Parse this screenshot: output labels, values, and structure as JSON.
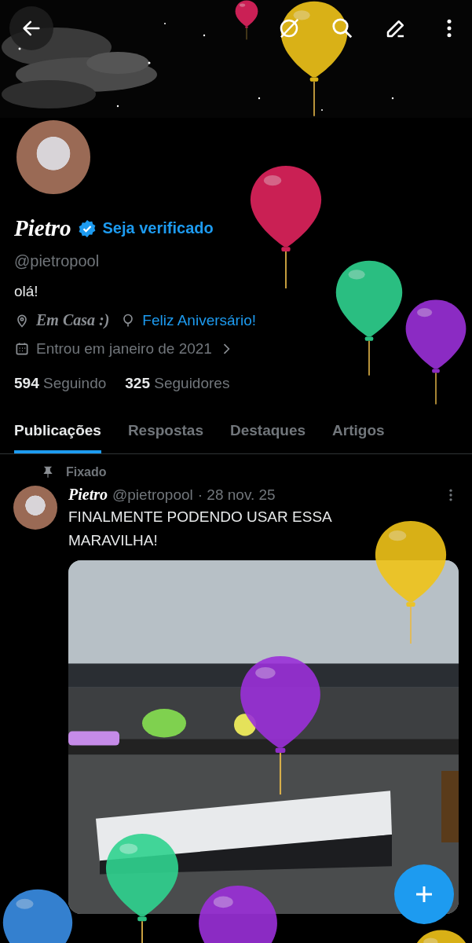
{
  "profile": {
    "name": "Pietro",
    "verified": true,
    "verify_link": "Seja verificado",
    "handle": "@pietropool",
    "bio": "olá!",
    "location": "Em Casa :)",
    "birthday": "Feliz Aniversário!",
    "joined": "Entrou em janeiro de 2021",
    "following_count": "594",
    "following_label": "Seguindo",
    "followers_count": "325",
    "followers_label": "Seguidores"
  },
  "tabs": [
    {
      "label": "Publicações",
      "selected": true
    },
    {
      "label": "Respostas",
      "selected": false
    },
    {
      "label": "Destaques",
      "selected": false
    },
    {
      "label": "Artigos",
      "selected": false
    }
  ],
  "pinned_label": "Fixado",
  "post": {
    "author": "Pietro",
    "handle": "@pietropool",
    "date": "· 28 nov. 25",
    "text": "FINALMENTE PODENDO USAR ESSA MARAVILHA!"
  }
}
